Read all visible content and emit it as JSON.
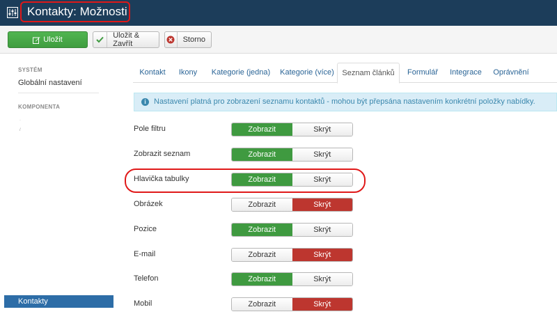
{
  "header": {
    "title": "Kontakty: Možnosti",
    "icon": "sliders-icon",
    "background": "#1c3d5a"
  },
  "toolbar": {
    "save_label": "Uložit",
    "save_close_label": "Uložit & Zavřít",
    "cancel_label": "Storno"
  },
  "sidebar": {
    "system_heading": "SYSTÉM",
    "global_settings": "Globální nastavení",
    "component_heading": "KOMPONENTA",
    "active_item": "Kontakty"
  },
  "tabs": [
    "Kontakt",
    "Ikony",
    "Kategorie (jedna)",
    "Kategorie (více)",
    "Seznam článků",
    "Formulář",
    "Integrace",
    "Oprávnění"
  ],
  "active_tab": "Seznam článků",
  "alert": {
    "text": "Nastavení platná pro zobrazení seznamu kontaktů - mohou být přepsána nastavením konkrétní položky nabídky."
  },
  "toggle_labels": {
    "yes": "Zobrazit",
    "no": "Skrýt"
  },
  "settings": [
    {
      "label": "Pole filtru",
      "value": "Zobrazit"
    },
    {
      "label": "Zobrazit seznam",
      "value": "Zobrazit"
    },
    {
      "label": "Hlavička tabulky",
      "value": "Zobrazit"
    },
    {
      "label": "Obrázek",
      "value": "Skrýt"
    },
    {
      "label": "Pozice",
      "value": "Zobrazit"
    },
    {
      "label": "E-mail",
      "value": "Skrýt"
    },
    {
      "label": "Telefon",
      "value": "Zobrazit"
    },
    {
      "label": "Mobil",
      "value": "Skrýt"
    }
  ],
  "colors": {
    "green": "#3f9a40",
    "red": "#bd362f",
    "blue": "#2d6da7",
    "annotation": "#e01818"
  }
}
